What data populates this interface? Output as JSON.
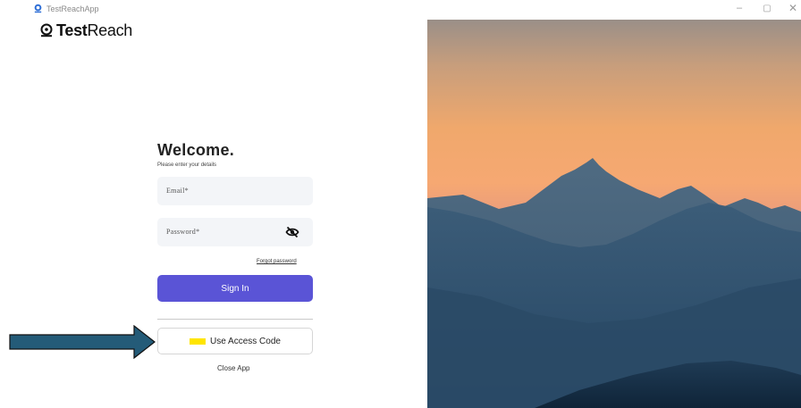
{
  "titlebar": {
    "app_title": "TestReachApp",
    "minimize_glyph": "–",
    "maximize_glyph": "▢",
    "close_glyph": "✕"
  },
  "logo": {
    "bold": "Test",
    "light": "Reach"
  },
  "login": {
    "heading": "Welcome.",
    "subtitle": "Please enter your details",
    "email_placeholder": "Email*",
    "password_placeholder": "Password*",
    "forgot_password": "Forgot password",
    "sign_in": "Sign In",
    "access_code": "Use Access Code",
    "close_app": "Close App"
  },
  "colors": {
    "primary": "#5a54d6",
    "highlight": "#ffe500",
    "arrow": "#245b78"
  },
  "icons": {
    "app": "testreach-logo-icon",
    "password_toggle": "eye-off-icon"
  }
}
